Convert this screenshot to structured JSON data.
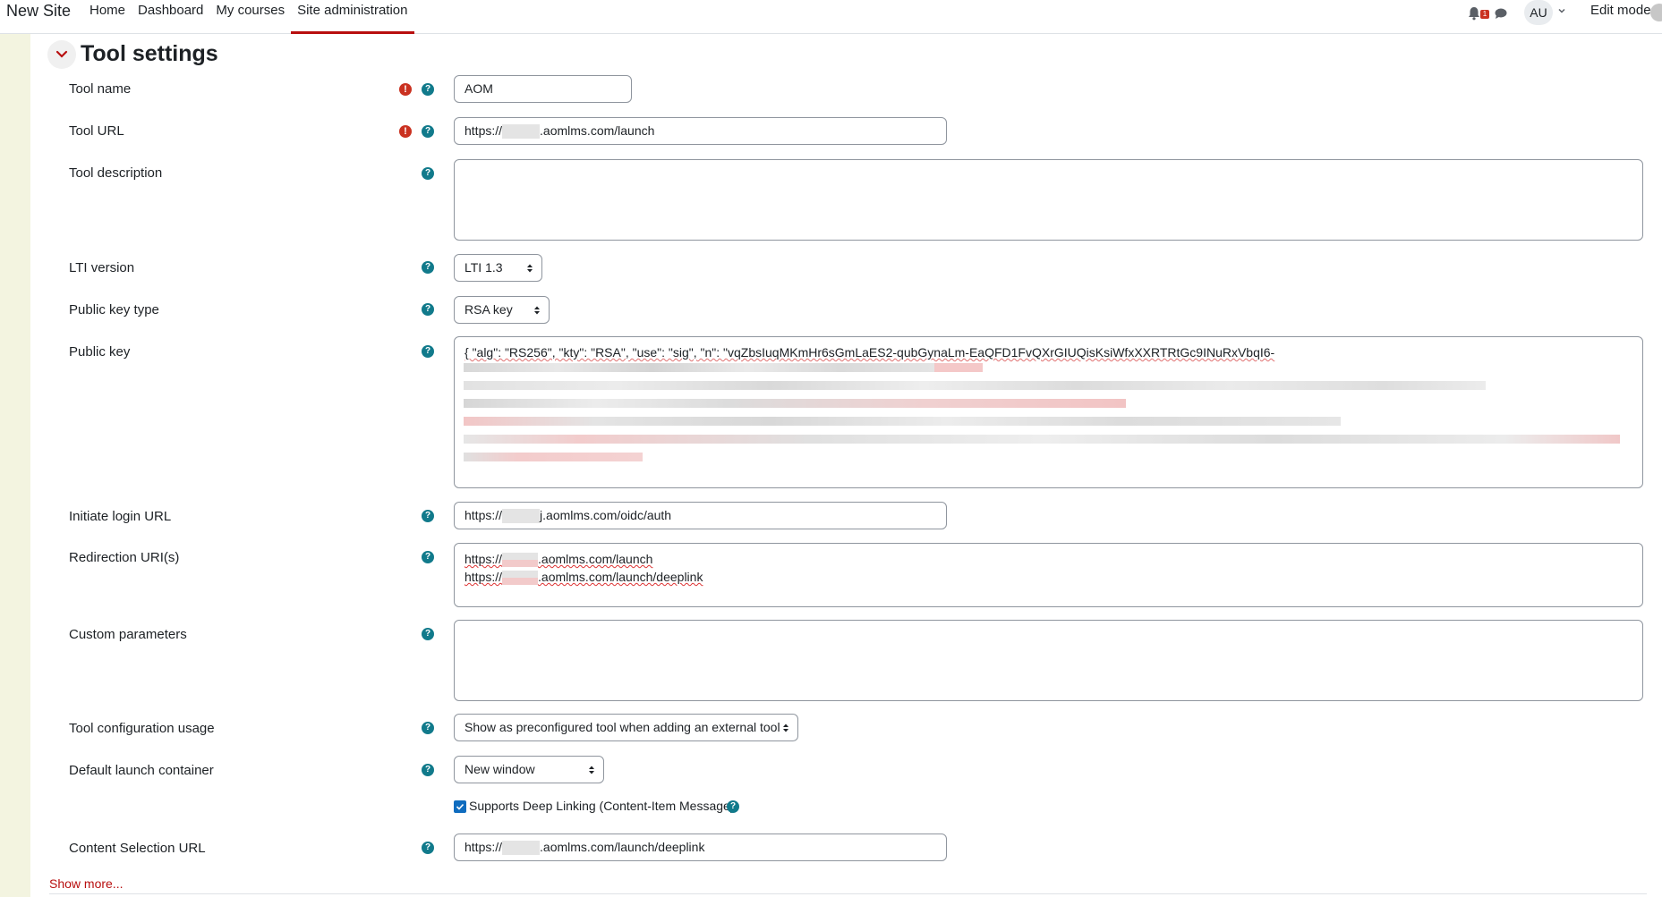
{
  "navbar": {
    "site_name": "New Site",
    "links": [
      {
        "label": "Home",
        "active": false
      },
      {
        "label": "Dashboard",
        "active": false
      },
      {
        "label": "My courses",
        "active": false
      },
      {
        "label": "Site administration",
        "active": true
      }
    ],
    "notification_count": "1",
    "avatar_initials": "AU",
    "edit_mode_label": "Edit mode",
    "icons": [
      "bell-icon",
      "chat-icon",
      "chevron-down-icon"
    ]
  },
  "section": {
    "title": "Tool settings",
    "collapse_icon": "chevron-down-icon"
  },
  "fields": {
    "tool_name": {
      "label": "Tool name",
      "value": "AOM",
      "required": true
    },
    "tool_url": {
      "label": "Tool URL",
      "value_prefix": "https://",
      "value_suffix": ".aomlms.com/launch",
      "required": true
    },
    "tool_description": {
      "label": "Tool description",
      "value": ""
    },
    "lti_version": {
      "label": "LTI version",
      "value": "LTI 1.3"
    },
    "public_key_type": {
      "label": "Public key type",
      "value": "RSA key"
    },
    "public_key": {
      "label": "Public key",
      "value_visible": "{  \"alg\": \"RS256\",  \"kty\": \"RSA\",  \"use\": \"sig\",  \"n\": \"vqZbsIuqMKmHr6sGmLaES2-qubGynaLm-EaQFD1FvQXrGIUQisKsiWfxXXRTRtGc9INuRxVbqI6-"
    },
    "initiate_login_url": {
      "label": "Initiate login URL",
      "value_prefix": "https://",
      "value_suffix": "j.aomlms.com/oidc/auth"
    },
    "redirection_uris": {
      "label": "Redirection URI(s)",
      "line1_prefix": "https://",
      "line1_suffix": ".aomlms.com/launch",
      "line2_prefix": "https://",
      "line2_suffix": ".aomlms.com/launch/deeplink"
    },
    "custom_parameters": {
      "label": "Custom parameters",
      "value": ""
    },
    "tool_configuration_usage": {
      "label": "Tool configuration usage",
      "value": "Show as preconfigured tool when adding an external tool"
    },
    "default_launch_container": {
      "label": "Default launch container",
      "value": "New window"
    },
    "supports_deep_linking": {
      "label": "Supports Deep Linking (Content-Item Message)",
      "checked": true
    },
    "content_selection_url": {
      "label": "Content Selection URL",
      "value_prefix": "https://",
      "value_suffix": ".aomlms.com/launch/deeplink"
    }
  },
  "show_more_label": "Show more...",
  "help_glyph": "?",
  "required_glyph": "!",
  "colors": {
    "accent": "#b80f0f",
    "required": "#ca3120",
    "help": "#117a8b",
    "checkbox": "#0f6cbf",
    "left_strip": "#f3f4e0"
  }
}
